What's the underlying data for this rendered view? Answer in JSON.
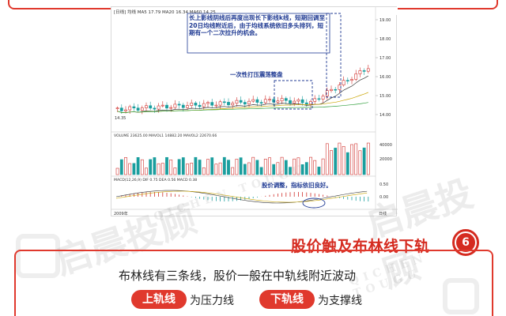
{
  "chart": {
    "header_text": "[日线] 均线  MA5 17.79  MA20 16.34  MA60 14.25",
    "price_low_label": "14.35",
    "price_axis": [
      "19.00",
      "18.00",
      "17.00",
      "16.00",
      "15.00",
      "14.00"
    ],
    "volume_header": "VOLUME 23625.00  MAVOL1 14882.20  MAVOL2 22670.66",
    "volume_axis": [
      "40000",
      "20000"
    ],
    "macd_header": "MACD(12,26,9)  DIF 0.75  DEA 0.56  MACD 0.38",
    "macd_axis": [
      "0.50",
      "0.00"
    ],
    "annotation_main": "长上影线阴线后再度出现长下影线k线，短期回调至20日均线附近后，由于均线系统依旧多头排列，短期有一个二次拉升的机会。",
    "annotation_box": "一次性打压震荡整盘",
    "annotation_macd": "股价调整，指标依旧良好。",
    "bottom_left_label": "2009年",
    "bottom_right_label": "日线",
    "colors": {
      "up": "#d0312d",
      "down": "#1b9e9e",
      "annotation": "#1f3a93"
    }
  },
  "section": {
    "title": "股价触及布林线下轨",
    "number": "6"
  },
  "content": {
    "description": "布林线有三条线，股价一般在中轨线附近波动",
    "upper_label": "上轨线",
    "upper_text": "为压力线",
    "lower_label": "下轨线",
    "lower_text": "为支撑线"
  },
  "watermark": {
    "text": "启晨投顾",
    "pinyin": "QICHEN TOUGU"
  }
}
